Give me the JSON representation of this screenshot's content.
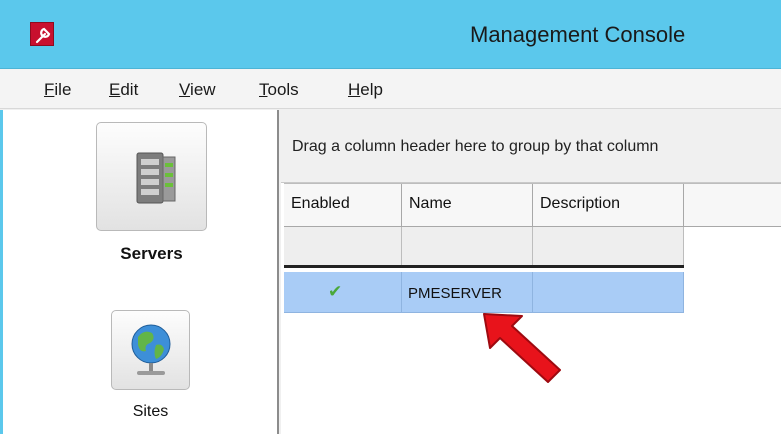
{
  "window": {
    "title": "Management Console",
    "app_icon": "wrench-icon"
  },
  "menu": [
    {
      "label": "File",
      "accel": "F",
      "rest": "ile"
    },
    {
      "label": "Edit",
      "accel": "E",
      "rest": "dit"
    },
    {
      "label": "View",
      "accel": "V",
      "rest": "iew"
    },
    {
      "label": "Tools",
      "accel": "T",
      "rest": "ools"
    },
    {
      "label": "Help",
      "accel": "H",
      "rest": "elp"
    }
  ],
  "sidebar": {
    "items": [
      {
        "label": "Servers",
        "icon": "server-icon",
        "selected": true
      },
      {
        "label": "Sites",
        "icon": "globe-icon",
        "selected": false
      }
    ]
  },
  "grid": {
    "group_hint": "Drag a column header here to group by that column",
    "columns": [
      "Enabled",
      "Name",
      "Description"
    ],
    "rows": [
      {
        "enabled": "✔",
        "name": "PMESERVER",
        "description": ""
      }
    ]
  },
  "colors": {
    "titlebar": "#5bc8ec",
    "selected_row": "#a9ccf6",
    "annotation_arrow": "#e8131b"
  }
}
